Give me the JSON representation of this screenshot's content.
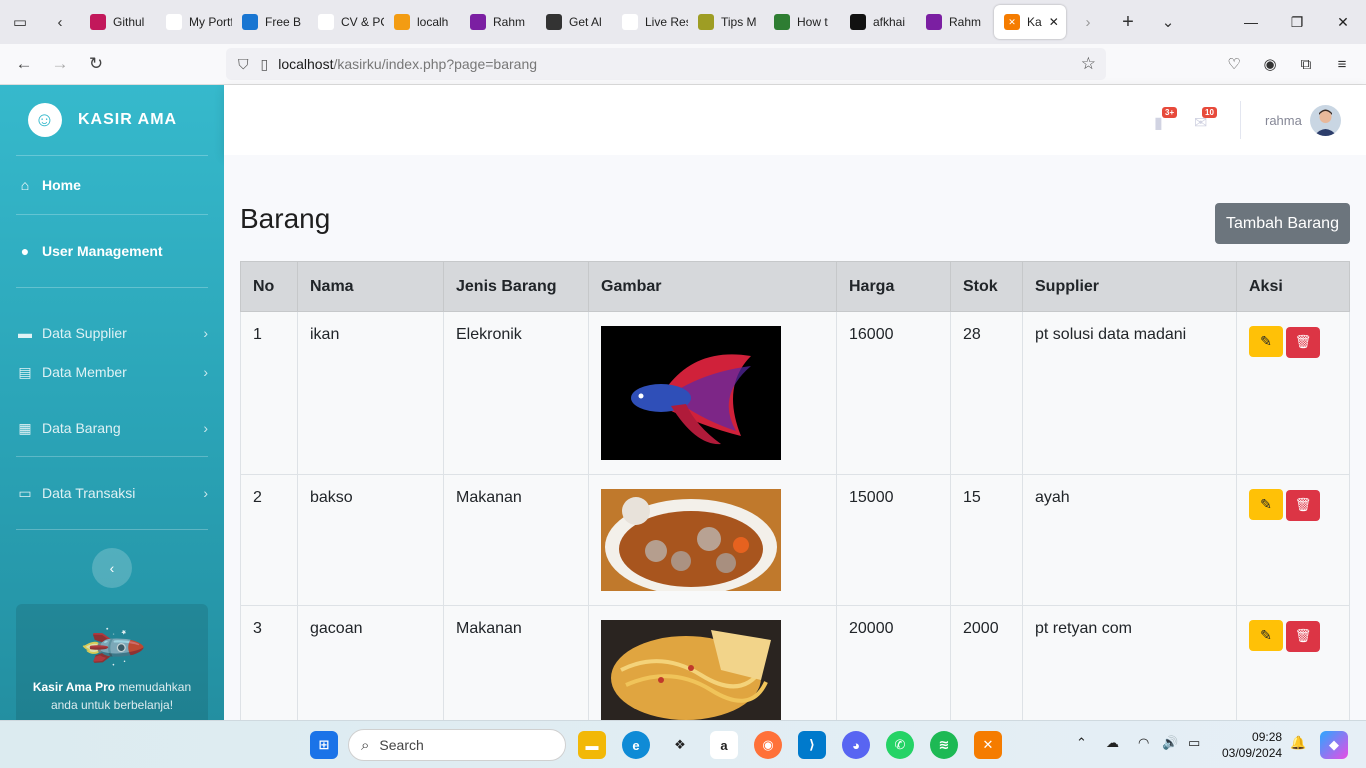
{
  "browser": {
    "tabs": [
      {
        "label": "Githul",
        "color": "#c2185b"
      },
      {
        "label": "My Portfo",
        "color": "#ffffff"
      },
      {
        "label": "Free B",
        "color": "#1976d2"
      },
      {
        "label": "CV & POR",
        "color": "#ffffff"
      },
      {
        "label": "localh",
        "color": "#f39c12"
      },
      {
        "label": "Rahm",
        "color": "#7b1fa2"
      },
      {
        "label": "Get Al",
        "color": "#333333"
      },
      {
        "label": "Live Resur",
        "color": "#ffffff"
      },
      {
        "label": "Tips M",
        "color": "#9e9d24"
      },
      {
        "label": "How t",
        "color": "#2e7d32"
      },
      {
        "label": "afkhai",
        "color": "#111111"
      },
      {
        "label": "Rahm",
        "color": "#7b1fa2"
      }
    ],
    "active_tab": {
      "label": "Ka",
      "color": "#f57c00"
    },
    "url_host": "localhost",
    "url_path": "/kasirku/index.php?page=barang"
  },
  "sidebar": {
    "brand": "KASIR AMA",
    "home": "Home",
    "user_management": "User Management",
    "items": [
      {
        "label": "Data Supplier",
        "icon": "truck-icon"
      },
      {
        "label": "Data Member",
        "icon": "building-icon"
      },
      {
        "label": "Data Barang",
        "icon": "box-icon"
      },
      {
        "label": "Data Transaksi",
        "icon": "credit-card-icon"
      }
    ],
    "promo_bold": "Kasir Ama Pro",
    "promo_text": " memudahkan anda untuk berbelanja!"
  },
  "topbar": {
    "alerts_badge": "3+",
    "messages_badge": "10",
    "username": "rahma"
  },
  "main": {
    "title": "Barang",
    "add_button": "Tambah Barang"
  },
  "table": {
    "headers": [
      "No",
      "Nama",
      "Jenis Barang",
      "Gambar",
      "Harga",
      "Stok",
      "Supplier",
      "Aksi"
    ],
    "rows": [
      {
        "no": "1",
        "nama": "ikan",
        "jenis": "Elekronik",
        "gambar": "betta-fish-photo",
        "harga": "16000",
        "stok": "28",
        "supplier": "pt solusi data madani"
      },
      {
        "no": "2",
        "nama": "bakso",
        "jenis": "Makanan",
        "gambar": "meatball-soup-photo",
        "harga": "15000",
        "stok": "15",
        "supplier": "ayah"
      },
      {
        "no": "3",
        "nama": "gacoan",
        "jenis": "Makanan",
        "gambar": "noodle-dish-photo",
        "harga": "20000",
        "stok": "2000",
        "supplier": "pt retyan com"
      }
    ]
  },
  "taskbar": {
    "search_placeholder": "Search",
    "time": "09:28",
    "date": "03/09/2024"
  }
}
